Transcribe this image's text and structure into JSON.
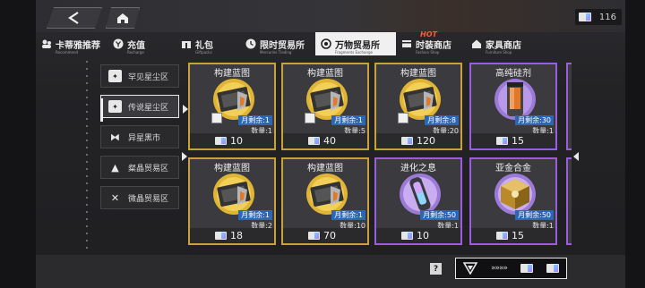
{
  "header": {
    "currency_value": "116"
  },
  "tabs": [
    {
      "label": "卡蒂雅推荐",
      "sub": "Recommend",
      "icon": "character-icon",
      "active": false
    },
    {
      "label": "充值",
      "sub": "Recharge",
      "icon": "recharge-icon",
      "active": false
    },
    {
      "label": "礼包",
      "sub": "Giftpacks",
      "icon": "gift-icon",
      "active": false
    },
    {
      "label": "限时贸易所",
      "sub": "Mercuries Trading",
      "icon": "limited-trade-icon",
      "active": false
    },
    {
      "label": "万物贸易所",
      "sub": "Fragments Exchange",
      "icon": "exchange-icon",
      "active": true
    },
    {
      "label": "时装商店",
      "sub": "Fashion Shop",
      "icon": "fashion-icon",
      "active": false
    },
    {
      "label": "家具商店",
      "sub": "Furniture Shop",
      "icon": "furniture-icon",
      "active": false
    }
  ],
  "hot_label": "HOT",
  "sidebar": {
    "items": [
      {
        "label": "罕见星尘区",
        "icon": "stardust-icon",
        "active": false
      },
      {
        "label": "传说星尘区",
        "icon": "stardust-icon",
        "active": true
      },
      {
        "label": "异星黑市",
        "icon": "black-market-icon",
        "active": false
      },
      {
        "label": "粲晶贸易区",
        "icon": "crystal-icon",
        "active": false
      },
      {
        "label": "微晶贸易区",
        "icon": "microcrystal-icon",
        "active": false
      }
    ]
  },
  "items": [
    {
      "title": "构建蓝图",
      "remain": "月剩余:1",
      "qty": "数量:1",
      "price": "10",
      "rarity": "gold",
      "kind": "blueprint"
    },
    {
      "title": "构建蓝图",
      "remain": "月剩余:1",
      "qty": "数量:5",
      "price": "40",
      "rarity": "gold",
      "kind": "blueprint"
    },
    {
      "title": "构建蓝图",
      "remain": "月剩余:8",
      "qty": "数量:20",
      "price": "120",
      "rarity": "gold",
      "kind": "blueprint"
    },
    {
      "title": "高纯硅剂",
      "remain": "月剩余:30",
      "qty": "数量:1",
      "price": "15",
      "rarity": "purple",
      "kind": "silicon"
    },
    {
      "title": "构建蓝图",
      "remain": "月剩余:1",
      "qty": "数量:2",
      "price": "18",
      "rarity": "gold",
      "kind": "blueprint"
    },
    {
      "title": "构建蓝图",
      "remain": "月剩余:1",
      "qty": "数量:10",
      "price": "70",
      "rarity": "gold",
      "kind": "blueprint"
    },
    {
      "title": "进化之息",
      "remain": "月剩余:50",
      "qty": "数量:1",
      "price": "10",
      "rarity": "purple",
      "kind": "evolution"
    },
    {
      "title": "亚金合金",
      "remain": "月剩余:50",
      "qty": "数量:1",
      "price": "15",
      "rarity": "purple",
      "kind": "alloy"
    }
  ],
  "footer": {
    "help_label": "?",
    "exchange_arrows": "»»»»"
  }
}
